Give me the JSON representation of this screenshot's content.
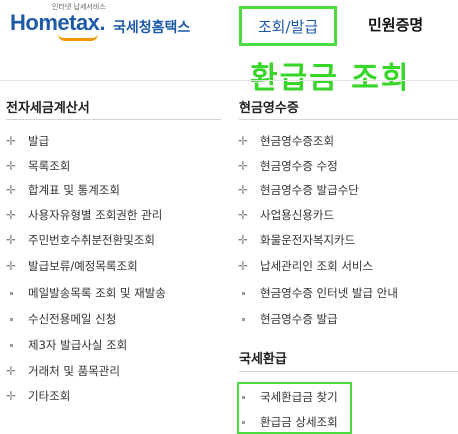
{
  "header": {
    "logo_tagline": "인터넷 납세서비스",
    "logo_main": "Hometax.",
    "logo_ko": "국세청홈택스",
    "nav": [
      {
        "label": "조회/발급"
      },
      {
        "label": "민원증명"
      }
    ]
  },
  "overlay_title": "환급금 조회",
  "left": {
    "title": "전자세금계산서",
    "items": [
      {
        "label": "발급",
        "marker": "plus"
      },
      {
        "label": "목록조회",
        "marker": "plus"
      },
      {
        "label": "합계표 및 통계조회",
        "marker": "plus"
      },
      {
        "label": "사용자유형별 조회권한 관리",
        "marker": "plus"
      },
      {
        "label": "주민번호수취분전환및조회",
        "marker": "plus"
      },
      {
        "label": "발급보류/예정목록조회",
        "marker": "plus"
      },
      {
        "label": "메일발송목록 조회 및 재발송",
        "marker": "dot"
      },
      {
        "label": "수신전용메일 신청",
        "marker": "dot"
      },
      {
        "label": "제3자 발급사실 조회",
        "marker": "dot"
      },
      {
        "label": "거래처 및 품목관리",
        "marker": "plus"
      },
      {
        "label": "기타조회",
        "marker": "plus"
      }
    ]
  },
  "right": {
    "title": "현금영수증",
    "items": [
      {
        "label": "현금영수증조회",
        "marker": "plus"
      },
      {
        "label": "현금영수증 수정",
        "marker": "plus"
      },
      {
        "label": "현금영수증 발급수단",
        "marker": "plus"
      },
      {
        "label": "사업용신용카드",
        "marker": "plus"
      },
      {
        "label": "화물운전자복지카드",
        "marker": "plus"
      },
      {
        "label": "납세관리인 조회 서비스",
        "marker": "plus"
      },
      {
        "label": "현금영수증 인터넷 발급 안내",
        "marker": "dot"
      },
      {
        "label": "현금영수증 발급",
        "marker": "dot"
      }
    ],
    "title2": "국세환급",
    "items2": [
      {
        "label": "국세환급금 찾기",
        "marker": "dot"
      },
      {
        "label": "환급금 상세조회",
        "marker": "dot"
      }
    ]
  },
  "colors": {
    "brand_blue": "#1e5aa8",
    "highlight_green": "#4bdc3f",
    "overlay_green": "#39d62a",
    "logo_orange": "#f39800"
  }
}
